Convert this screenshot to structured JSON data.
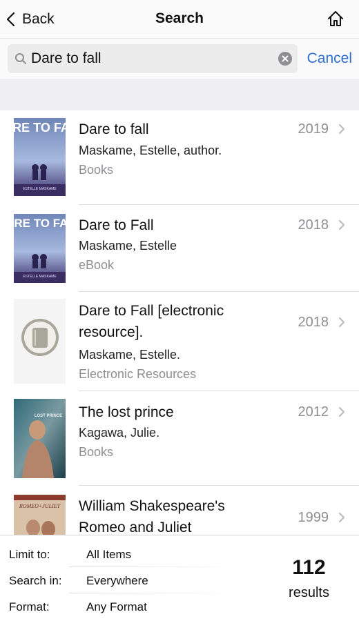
{
  "nav": {
    "back_label": "Back",
    "title": "Search"
  },
  "search": {
    "value": "Dare to fall",
    "cancel_label": "Cancel"
  },
  "results": [
    {
      "title": "Dare to fall",
      "author": "Maskame, Estelle, author.",
      "format": "Books",
      "year": "2019",
      "cover_text": "DARE TO FALL",
      "cover_author": "ESTELLE MASKAME"
    },
    {
      "title": "Dare to Fall",
      "author": "Maskame, Estelle",
      "format": "eBook",
      "year": "2018",
      "cover_text": "DARE TO FALL",
      "cover_author": "ESTELLE MASKAME"
    },
    {
      "title": "Dare to Fall [electronic resource].",
      "author": "Maskame, Estelle.",
      "format": "Electronic Resources",
      "year": "2018"
    },
    {
      "title": "The lost prince",
      "author": "Kagawa, Julie.",
      "format": "Books",
      "year": "2012",
      "cover_text": "LOST PRINCE"
    },
    {
      "title": "William Shakespeare's Romeo and Juliet",
      "year": "1999",
      "cover_text": "ROMEO+JULIET"
    }
  ],
  "footer": {
    "limit_label": "Limit to:",
    "limit_value": "All Items",
    "search_in_label": "Search in:",
    "search_in_value": "Everywhere",
    "format_label": "Format:",
    "format_value": "Any Format",
    "count": "112",
    "count_label": "results"
  },
  "colors": {
    "accent": "#2e6fd1",
    "secondary_text": "#8e8e93",
    "separator_band": "#efeff2"
  },
  "icons": [
    "back-chevron-icon",
    "home-icon",
    "search-icon",
    "clear-icon",
    "book-icon",
    "chevron-right-icon"
  ]
}
